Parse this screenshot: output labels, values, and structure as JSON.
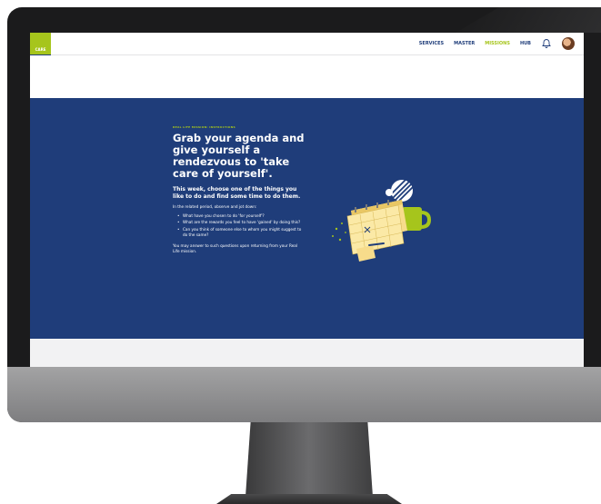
{
  "app": {
    "logo_text": "CARE"
  },
  "nav": {
    "items": [
      {
        "label": "SERVICES",
        "active": false
      },
      {
        "label": "MASTER",
        "active": false
      },
      {
        "label": "MISSIONS",
        "active": true
      },
      {
        "label": "HUB",
        "active": false
      }
    ],
    "icons": [
      "bell-icon",
      "user-avatar"
    ]
  },
  "mission": {
    "kicker": "REAL LIFE MISSION: INSTRUCTIONS",
    "title": "Grab your agenda and give yourself a rendezvous to 'take care of yourself'.",
    "subtitle": "This week, choose one of the things you like to do and find some time to do them.",
    "intro": "In the related period, observe and jot down:",
    "bullets": [
      "What have you chosen to do 'for yourself'?",
      "What are the rewards you feel to have 'gained' by doing this?",
      "Can you think of someone else to whom you might suggest to do the same?"
    ],
    "closing": "You may answer to such questions upon returning from your Real Life mission."
  },
  "colors": {
    "brand_blue": "#1f3d7a",
    "accent_green": "#a6c51c"
  }
}
